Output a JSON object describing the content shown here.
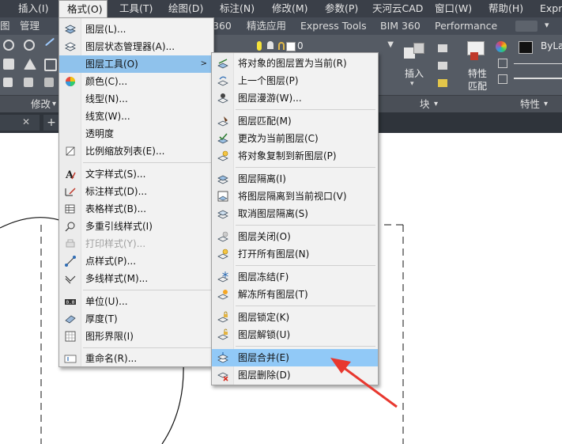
{
  "menubar": {
    "items": [
      "插入(I)",
      "格式(O)",
      "工具(T)",
      "绘图(D)",
      "标注(N)",
      "修改(M)",
      "参数(P)",
      "天河云CAD",
      "窗口(W)",
      "帮助(H)",
      "Expr"
    ]
  },
  "ribbon_tabs": {
    "items": [
      "图",
      "管理",
      "360",
      "精选应用",
      "Express Tools",
      "BIM 360",
      "Performance"
    ]
  },
  "ribbon": {
    "layer_name": "0",
    "insert_label": "插入",
    "properties_label": "特性",
    "match_label": "匹配",
    "bylayer": "ByLa"
  },
  "panel_bar": {
    "modify": "修改",
    "block": "块",
    "properties": "特性"
  },
  "format_menu": {
    "items": [
      {
        "label": "图层(L)...",
        "icon": "layer-icon"
      },
      {
        "label": "图层状态管理器(A)...",
        "icon": "layer-state-icon"
      },
      {
        "label": "图层工具(O)",
        "icon": "layer-tools-icon"
      },
      {
        "label": "颜色(C)...",
        "icon": "color-wheel-icon"
      },
      {
        "label": "线型(N)...",
        "icon": ""
      },
      {
        "label": "线宽(W)...",
        "icon": ""
      },
      {
        "label": "透明度",
        "icon": ""
      },
      {
        "label": "比例缩放列表(E)...",
        "icon": "scale-list-icon"
      },
      {
        "label": "文字样式(S)...",
        "icon": "text-style-icon"
      },
      {
        "label": "标注样式(D)...",
        "icon": "dim-style-icon"
      },
      {
        "label": "表格样式(B)...",
        "icon": "table-style-icon"
      },
      {
        "label": "多重引线样式(I)",
        "icon": "mleader-style-icon"
      },
      {
        "label": "打印样式(Y)...",
        "icon": "plot-style-icon"
      },
      {
        "label": "点样式(P)...",
        "icon": "point-style-icon"
      },
      {
        "label": "多线样式(M)...",
        "icon": "mline-style-icon"
      },
      {
        "label": "单位(U)...",
        "icon": "units-icon"
      },
      {
        "label": "厚度(T)",
        "icon": "thickness-icon"
      },
      {
        "label": "图形界限(I)",
        "icon": "limits-icon"
      },
      {
        "label": "重命名(R)...",
        "icon": "rename-icon"
      }
    ]
  },
  "layer_tools_menu": {
    "items": [
      {
        "label": "将对象的图层置为当前(R)",
        "icon": "layer-make-current-icon"
      },
      {
        "label": "上一个图层(P)",
        "icon": "layer-previous-icon"
      },
      {
        "label": "图层漫游(W)...",
        "icon": "layer-walk-icon"
      },
      {
        "label": "图层匹配(M)",
        "icon": "layer-match-icon"
      },
      {
        "label": "更改为当前图层(C)",
        "icon": "change-to-current-icon"
      },
      {
        "label": "将对象复制到新图层(P)",
        "icon": "copy-to-layer-icon"
      },
      {
        "label": "图层隔离(I)",
        "icon": "layer-isolate-icon"
      },
      {
        "label": "将图层隔离到当前视口(V)",
        "icon": "isolate-viewport-icon"
      },
      {
        "label": "取消图层隔离(S)",
        "icon": "layer-unisolate-icon"
      },
      {
        "label": "图层关闭(O)",
        "icon": "layer-off-icon"
      },
      {
        "label": "打开所有图层(N)",
        "icon": "layer-on-icon"
      },
      {
        "label": "图层冻结(F)",
        "icon": "layer-freeze-icon"
      },
      {
        "label": "解冻所有图层(T)",
        "icon": "layer-thaw-icon"
      },
      {
        "label": "图层锁定(K)",
        "icon": "layer-lock-icon"
      },
      {
        "label": "图层解锁(U)",
        "icon": "layer-unlock-icon"
      },
      {
        "label": "图层合并(E)",
        "icon": "layer-merge-icon"
      },
      {
        "label": "图层删除(D)",
        "icon": "layer-delete-icon"
      }
    ]
  },
  "colors": {
    "highlight": "#91c9f7",
    "arrow": "#e8382f",
    "menubar": "#3a3f48"
  }
}
